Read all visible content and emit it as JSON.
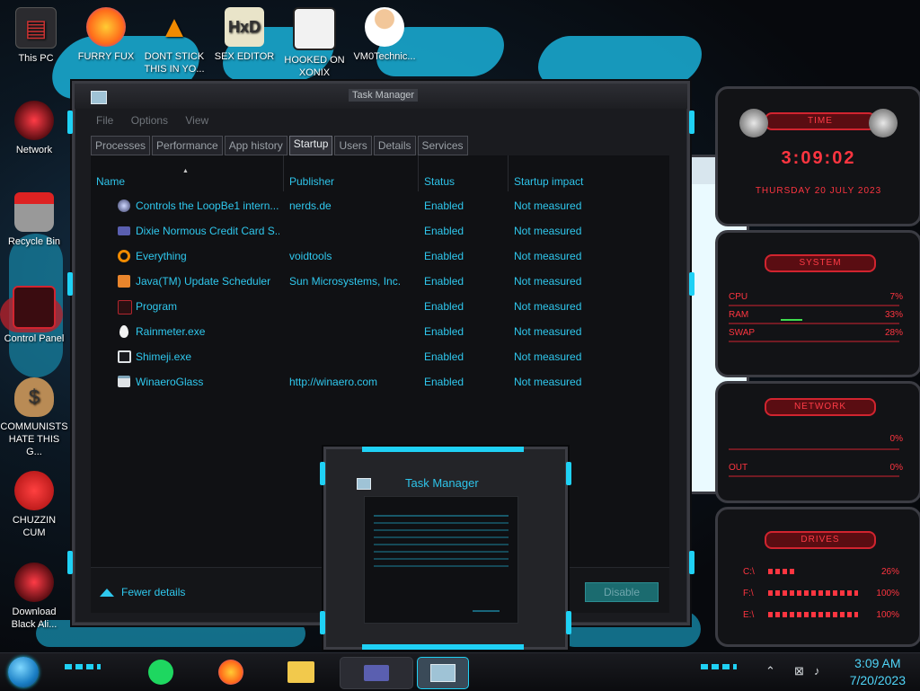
{
  "desktop_icons": [
    {
      "label": "This PC",
      "icon": "pc-icon"
    },
    {
      "label": "FURRY FUX",
      "icon": "firefox-icon"
    },
    {
      "label": "DONT STICK THIS IN YO...",
      "icon": "vlc-icon"
    },
    {
      "label": "SEX EDITOR",
      "icon": "hxd-icon"
    },
    {
      "label": "HOOKED ON XONIX",
      "icon": "game-icon"
    },
    {
      "label": "VM0Technic...",
      "icon": "doctor-icon"
    },
    {
      "label": "Network",
      "icon": "network-icon"
    },
    {
      "label": "Recycle Bin",
      "icon": "recycle-bin-icon"
    },
    {
      "label": "Control Panel",
      "icon": "control-panel-icon"
    },
    {
      "label": "COMMUNISTS HATE THIS G...",
      "icon": "money-bag-icon"
    },
    {
      "label": "CHUZZIN CUM",
      "icon": "chuzzle-icon"
    },
    {
      "label": "Download Black Ali...",
      "icon": "alien-icon"
    }
  ],
  "task_manager": {
    "title": "Task Manager",
    "menu": [
      "File",
      "Options",
      "View"
    ],
    "tabs": [
      "Processes",
      "Performance",
      "App history",
      "Startup",
      "Users",
      "Details",
      "Services"
    ],
    "active_tab": "Startup",
    "columns": [
      "Name",
      "Publisher",
      "Status",
      "Startup impact"
    ],
    "rows": [
      {
        "name": "Controls the LoopBe1 intern...",
        "publisher": "nerds.de",
        "status": "Enabled",
        "impact": "Not measured",
        "icon": "loopbe-icon"
      },
      {
        "name": "Dixie Normous Credit Card S...",
        "publisher": "",
        "status": "Enabled",
        "impact": "Not measured",
        "icon": "credit-card-icon"
      },
      {
        "name": "Everything",
        "publisher": "voidtools",
        "status": "Enabled",
        "impact": "Not measured",
        "icon": "magnifier-icon"
      },
      {
        "name": "Java(TM) Update Scheduler",
        "publisher": "Sun Microsystems, Inc.",
        "status": "Enabled",
        "impact": "Not measured",
        "icon": "java-icon"
      },
      {
        "name": "Program",
        "publisher": "",
        "status": "Enabled",
        "impact": "Not measured",
        "icon": "program-icon"
      },
      {
        "name": "Rainmeter.exe",
        "publisher": "",
        "status": "Enabled",
        "impact": "Not measured",
        "icon": "rainmeter-icon"
      },
      {
        "name": "Shimeji.exe",
        "publisher": "",
        "status": "Enabled",
        "impact": "Not measured",
        "icon": "shimeji-icon"
      },
      {
        "name": "WinaeroGlass",
        "publisher": "http://winaero.com",
        "status": "Enabled",
        "impact": "Not measured",
        "icon": "window-icon"
      }
    ],
    "fewer_details": "Fewer details",
    "disable_button": "Disable"
  },
  "preview": {
    "title": "Task Manager"
  },
  "gadgets": {
    "time": {
      "header": "TIME",
      "clock": "3:09:02",
      "date": "THURSDAY 20 JULY 2023"
    },
    "system": {
      "header": "SYSTEM",
      "cpu_label": "CPU",
      "cpu_value": "7%",
      "ram_label": "RAM",
      "ram_value": "33%",
      "swap_label": "SWAP",
      "swap_value": "28%"
    },
    "network": {
      "header": "NETWORK",
      "in_value": "0%",
      "out_label": "OUT",
      "out_value": "0%"
    },
    "drives": {
      "header": "DRIVES",
      "c_label": "C:\\",
      "c_value": "26%",
      "f_label": "F:\\",
      "f_value": "100%",
      "e_label": "E:\\",
      "e_value": "100%"
    }
  },
  "taskbar": {
    "time": "3:09 AM",
    "date": "7/20/2023"
  },
  "colors": {
    "accent": "#1fd1f5",
    "text_cyan": "#2fc8ee",
    "gadget_red": "#ff3540"
  }
}
